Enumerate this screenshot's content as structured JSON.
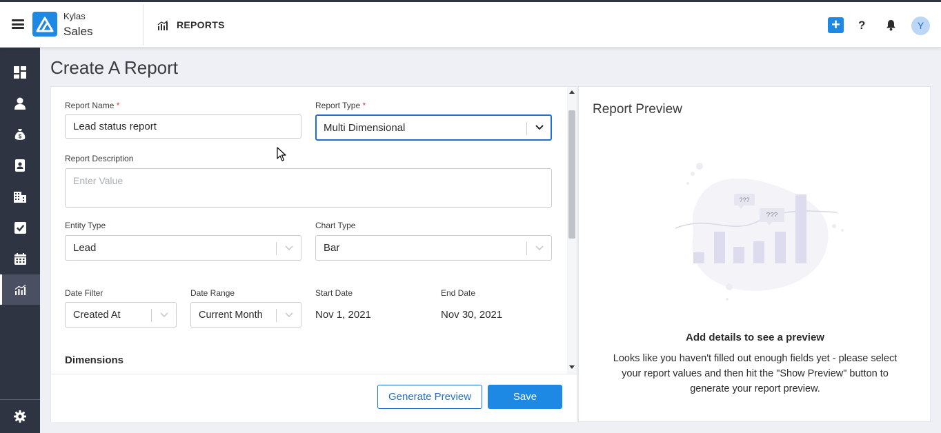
{
  "header": {
    "brand_top": "Kylas",
    "brand_bottom": "Sales",
    "section_title": "REPORTS",
    "avatar_initial": "Y",
    "help_label": "?",
    "plus_label": "+"
  },
  "sidebar": {
    "items": [
      {
        "icon": "dashboard-icon"
      },
      {
        "icon": "user-icon"
      },
      {
        "icon": "money-bag-icon"
      },
      {
        "icon": "contact-book-icon"
      },
      {
        "icon": "building-icon"
      },
      {
        "icon": "checkbox-icon"
      },
      {
        "icon": "calendar-icon"
      },
      {
        "icon": "reports-icon",
        "active": true
      }
    ],
    "bottom_icon": "gear-icon"
  },
  "page": {
    "title": "Create A Report"
  },
  "form": {
    "report_name": {
      "label": "Report Name",
      "required_mark": "*",
      "value": "Lead status report"
    },
    "report_type": {
      "label": "Report Type",
      "required_mark": "*",
      "value": "Multi Dimensional"
    },
    "report_description": {
      "label": "Report Description",
      "placeholder": "Enter Value"
    },
    "entity_type": {
      "label": "Entity Type",
      "value": "Lead"
    },
    "chart_type": {
      "label": "Chart Type",
      "value": "Bar"
    },
    "date_filter": {
      "label": "Date Filter",
      "value": "Created At"
    },
    "date_range": {
      "label": "Date Range",
      "value": "Current Month"
    },
    "start_date": {
      "label": "Start Date",
      "value": "Nov 1, 2021"
    },
    "end_date": {
      "label": "End Date",
      "value": "Nov 30, 2021"
    },
    "dimensions_title": "Dimensions"
  },
  "footer": {
    "generate_preview_label": "Generate Preview",
    "save_label": "Save"
  },
  "preview": {
    "title": "Report Preview",
    "bubble_text": "???",
    "heading": "Add details to see a preview",
    "text": "Looks like you haven't filled out enough fields yet - please select your report values and then hit the \"Show Preview\" button to generate your report preview."
  },
  "colors": {
    "accent": "#1e88e5",
    "sidebar_bg": "#2f3442",
    "required": "#e53935"
  }
}
